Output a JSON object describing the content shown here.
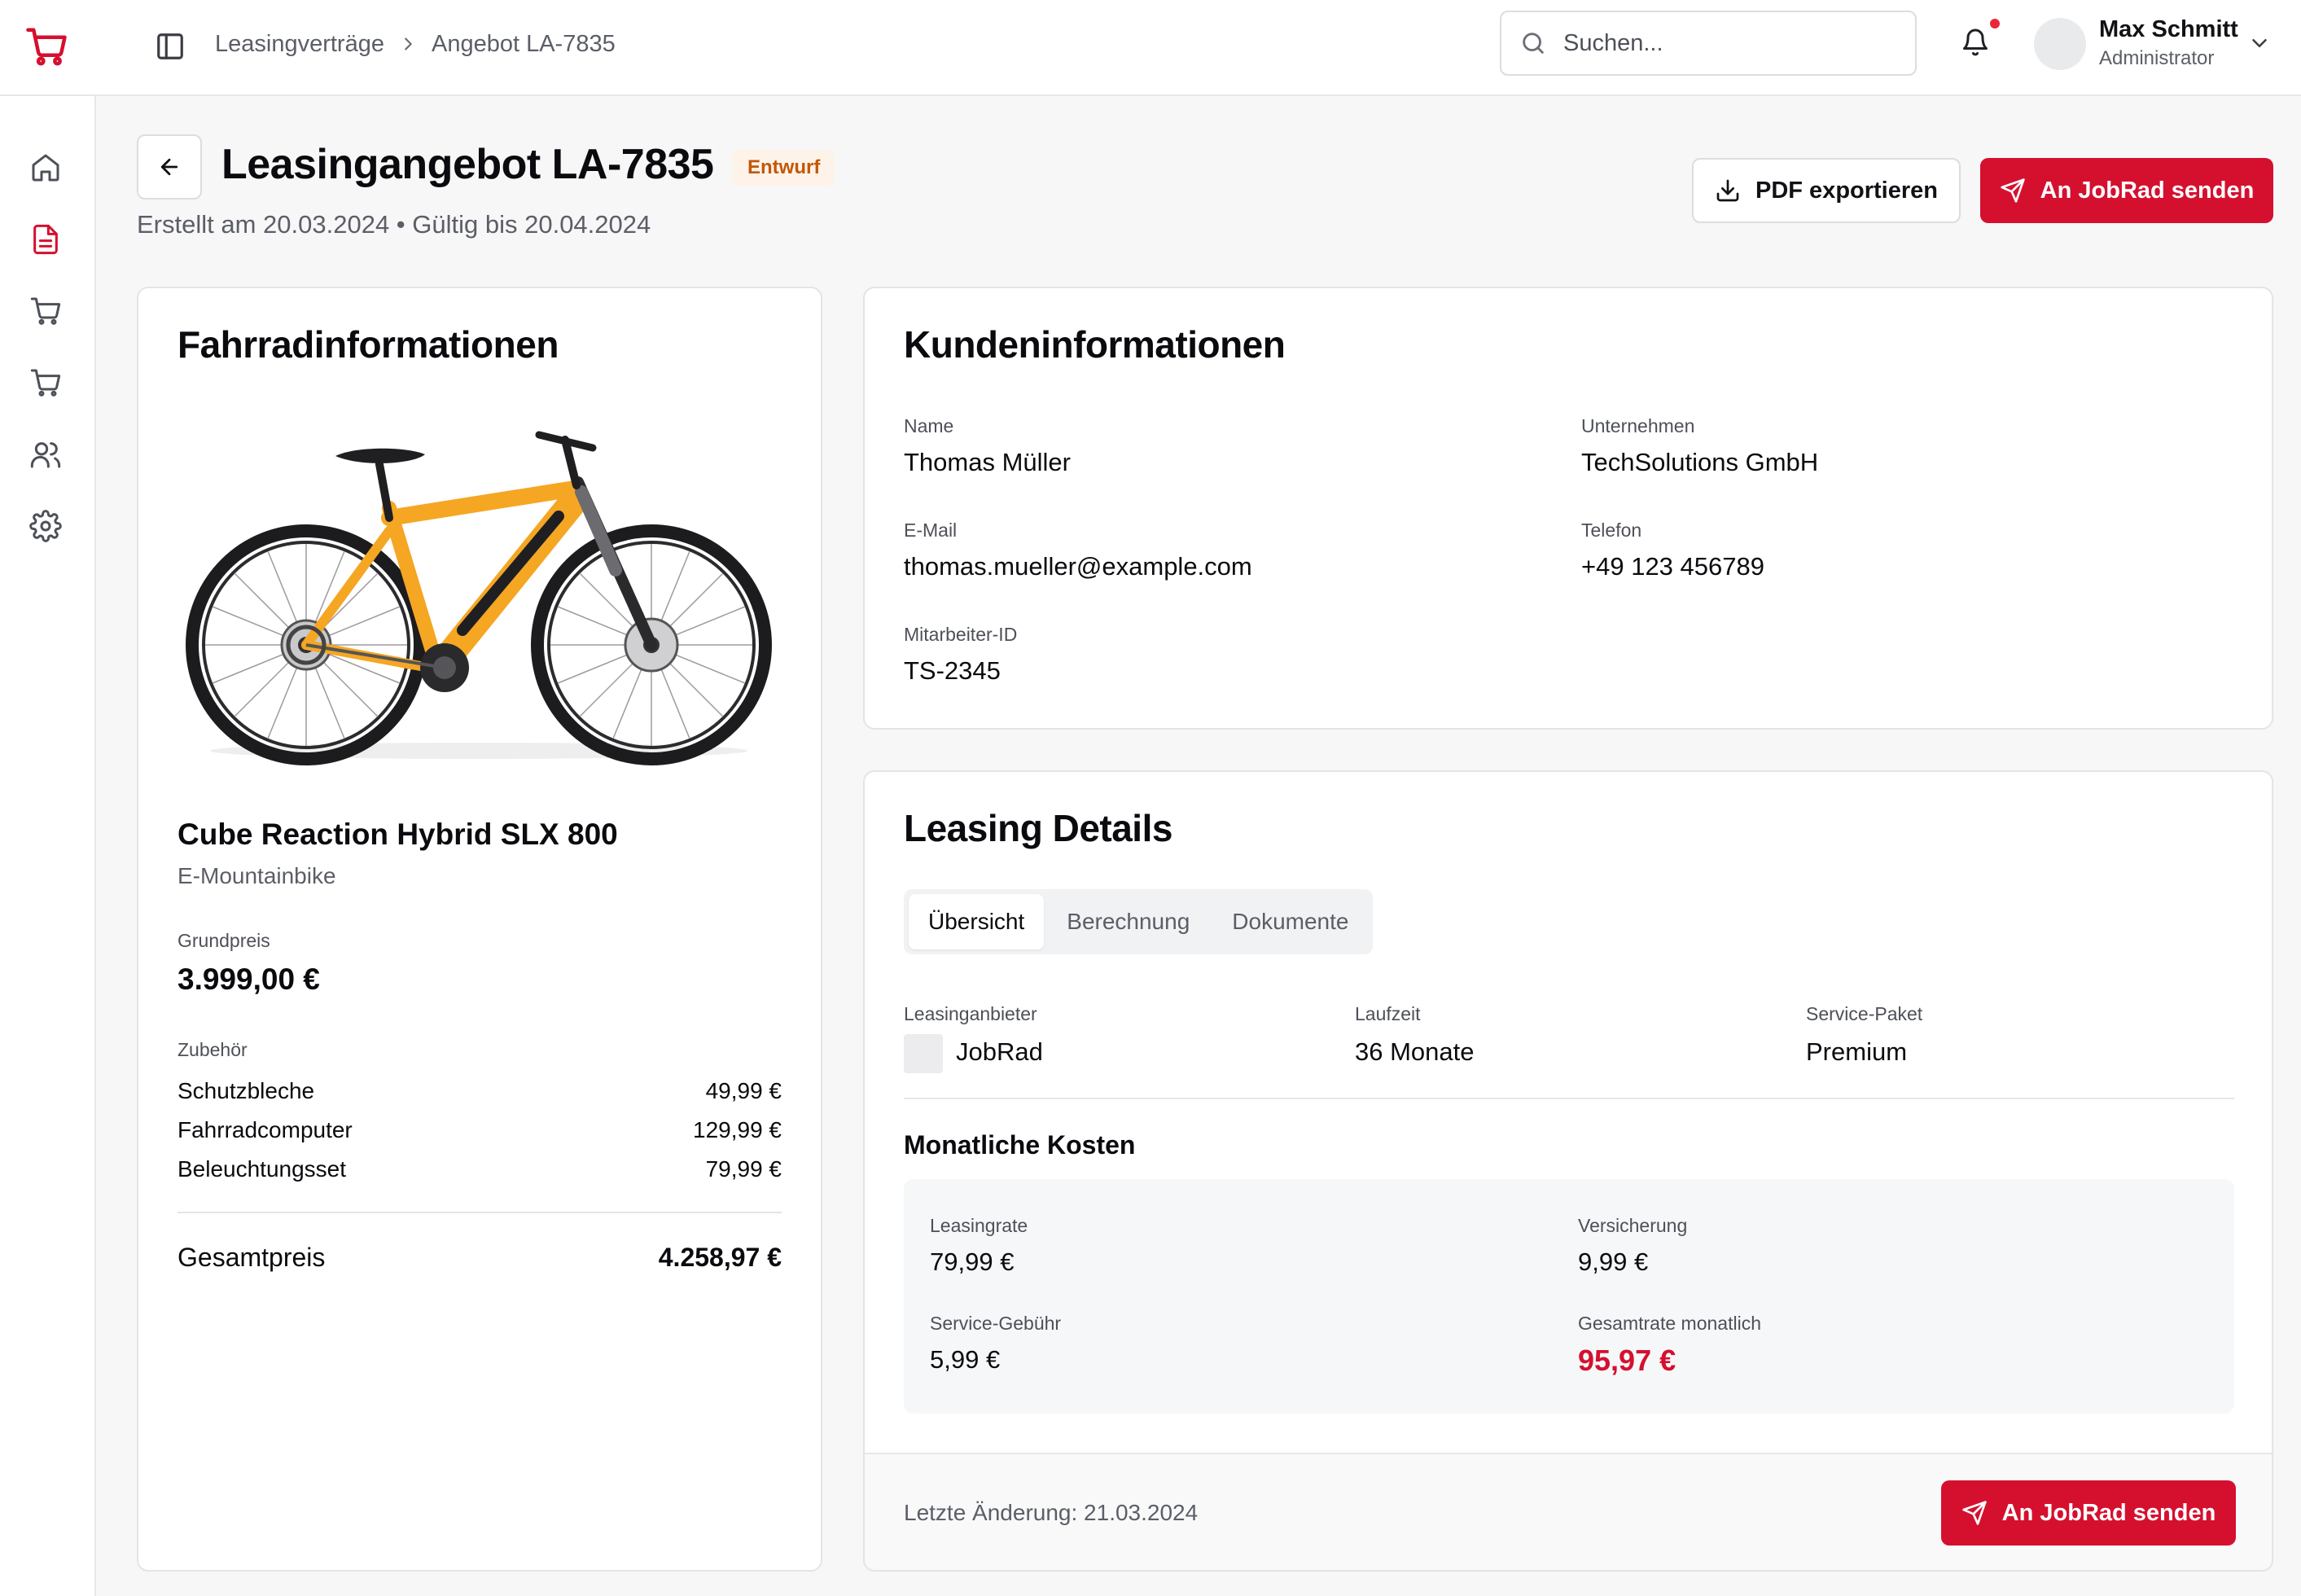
{
  "header": {
    "breadcrumb": [
      "Leasingverträge",
      "Angebot LA-7835"
    ],
    "search_placeholder": "Suchen...",
    "user": {
      "name": "Max Schmitt",
      "role": "Administrator"
    }
  },
  "sidebar": {
    "items": [
      {
        "icon": "home-icon",
        "active": false
      },
      {
        "icon": "document-icon",
        "active": true
      },
      {
        "icon": "cart-icon",
        "active": false
      },
      {
        "icon": "cart-icon",
        "active": false
      },
      {
        "icon": "users-icon",
        "active": false
      },
      {
        "icon": "gear-icon",
        "active": false
      }
    ]
  },
  "page": {
    "title": "Leasingangebot LA-7835",
    "status": "Entwurf",
    "meta": "Erstellt am 20.03.2024 • Gültig bis 20.04.2024",
    "export_label": "PDF exportieren",
    "send_label": "An JobRad senden"
  },
  "bike": {
    "section_title": "Fahrradinformationen",
    "name": "Cube Reaction Hybrid SLX 800",
    "category": "E-Mountainbike",
    "base_price_label": "Grundpreis",
    "base_price": "3.999,00 €",
    "accessories_label": "Zubehör",
    "accessories": [
      {
        "name": "Schutzbleche",
        "price": "49,99 €"
      },
      {
        "name": "Fahrradcomputer",
        "price": "129,99 €"
      },
      {
        "name": "Beleuchtungsset",
        "price": "79,99 €"
      }
    ],
    "total_label": "Gesamtpreis",
    "total": "4.258,97 €"
  },
  "customer": {
    "section_title": "Kundeninformationen",
    "fields": {
      "name": {
        "label": "Name",
        "value": "Thomas Müller"
      },
      "company": {
        "label": "Unternehmen",
        "value": "TechSolutions GmbH"
      },
      "email": {
        "label": "E-Mail",
        "value": "thomas.mueller@example.com"
      },
      "phone": {
        "label": "Telefon",
        "value": "+49 123 456789"
      },
      "employee_id": {
        "label": "Mitarbeiter-ID",
        "value": "TS-2345"
      }
    }
  },
  "leasing": {
    "section_title": "Leasing Details",
    "tabs": [
      "Übersicht",
      "Berechnung",
      "Dokumente"
    ],
    "active_tab": "Übersicht",
    "provider": {
      "label": "Leasinganbieter",
      "value": "JobRad"
    },
    "duration": {
      "label": "Laufzeit",
      "value": "36 Monate"
    },
    "service_package": {
      "label": "Service-Paket",
      "value": "Premium"
    },
    "monthly_costs_title": "Monatliche Kosten",
    "costs": {
      "rate": {
        "label": "Leasingrate",
        "value": "79,99 €"
      },
      "insurance": {
        "label": "Versicherung",
        "value": "9,99 €"
      },
      "service_fee": {
        "label": "Service-Gebühr",
        "value": "5,99 €"
      },
      "total_monthly": {
        "label": "Gesamtrate monatlich",
        "value": "95,97 €"
      }
    },
    "last_change": "Letzte Änderung: 21.03.2024",
    "send_label": "An JobRad senden"
  },
  "colors": {
    "accent": "#d5102f",
    "badge_bg": "#fef3e8",
    "badge_text": "#c25708",
    "bike_frame": "#f5a623"
  }
}
